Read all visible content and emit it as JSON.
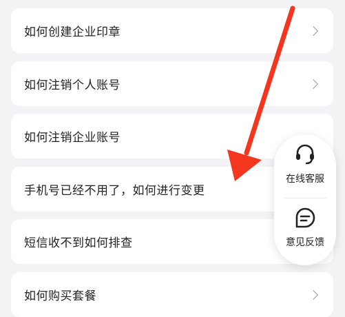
{
  "faq": {
    "items": [
      {
        "label": "如何创建企业印章",
        "has_chevron": true
      },
      {
        "label": "如何注销个人账号",
        "has_chevron": true
      },
      {
        "label": "如何注销企业账号",
        "has_chevron": false
      },
      {
        "label": "手机号已经不用了，如何进行变更",
        "has_chevron": false
      },
      {
        "label": "短信收不到如何排查",
        "has_chevron": false
      },
      {
        "label": "如何购买套餐",
        "has_chevron": true
      }
    ]
  },
  "float_menu": {
    "customer_service": {
      "label": "在线客服",
      "icon": "headset-icon"
    },
    "feedback": {
      "label": "意见反馈",
      "icon": "feedback-icon"
    }
  },
  "annotation": {
    "icon": "red-arrow-icon",
    "color": "#f4361f"
  },
  "colors": {
    "background": "#f3f3f5",
    "card": "#ffffff",
    "text": "#222222",
    "chevron": "#9a9a9a"
  }
}
